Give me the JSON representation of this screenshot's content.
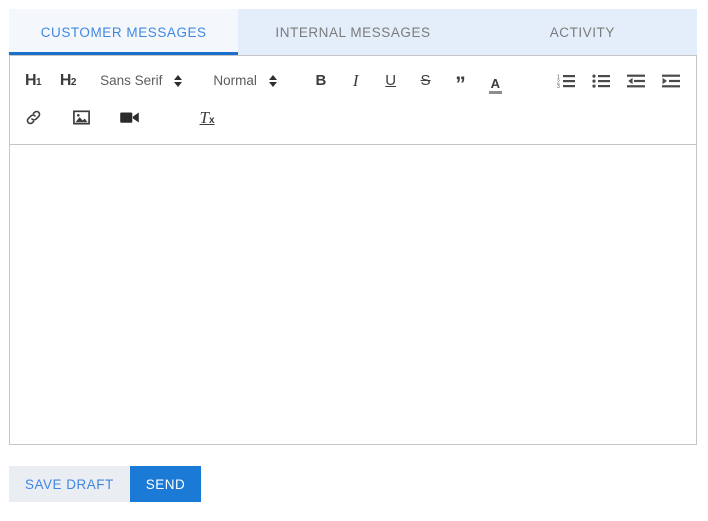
{
  "tabs": [
    {
      "label": "CUSTOMER MESSAGES",
      "active": true,
      "name": "tab-customer-messages"
    },
    {
      "label": "INTERNAL MESSAGES",
      "active": false,
      "name": "tab-internal-messages"
    },
    {
      "label": "ACTIVITY",
      "active": false,
      "name": "tab-activity"
    }
  ],
  "toolbar": {
    "heading1_label": "H",
    "heading1_sub": "1",
    "heading2_label": "H",
    "heading2_sub": "2",
    "font_family_value": "Sans Serif",
    "font_size_value": "Normal",
    "bold_label": "B",
    "italic_label": "I",
    "underline_label": "U",
    "strike_label": "S",
    "blockquote_label": "”",
    "text_color_label": "A",
    "clear_format_label": "T",
    "clear_format_sub": "x",
    "icons": {
      "attachment": "link-icon",
      "image": "image-icon",
      "video": "video-icon",
      "ordered_list": "ordered-list-icon",
      "bullet_list": "bullet-list-icon",
      "outdent": "outdent-icon",
      "indent": "indent-icon",
      "font_family_chevron": "chevron-updown-icon",
      "font_size_chevron": "chevron-updown-icon"
    }
  },
  "editor": {
    "content": "",
    "placeholder": ""
  },
  "footer": {
    "save_draft_label": "SAVE DRAFT",
    "send_label": "SEND"
  },
  "colors": {
    "accent_blue": "#1b7ad6",
    "tab_active_text": "#4187e0",
    "tab_bar_bg": "#e4eefa",
    "tab_active_bg": "#f4f8fd",
    "tab_inactive_text": "#7b7b7b",
    "underline_blue": "#1b70cb",
    "border_gray": "#c5c5c5",
    "secondary_btn_bg": "#eaeef2",
    "icon_gray": "#3d3d3d"
  }
}
